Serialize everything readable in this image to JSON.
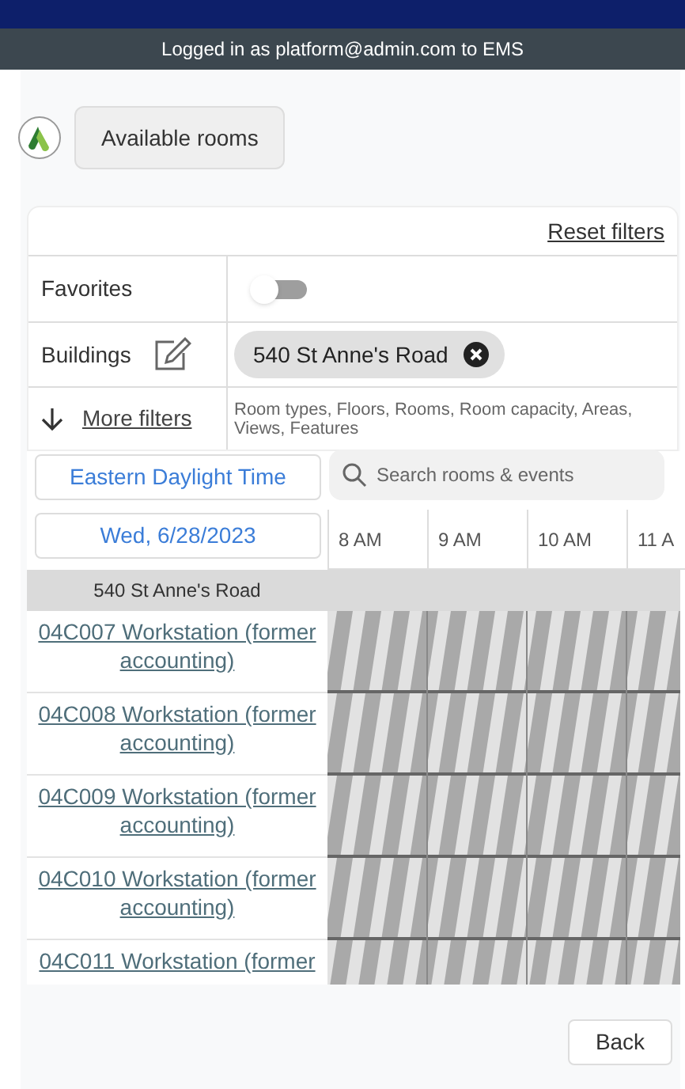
{
  "header": {
    "login_text": "Logged in as platform@admin.com to EMS"
  },
  "page_button": "Available rooms",
  "filters": {
    "reset": "Reset filters",
    "favorites": {
      "label": "Favorites",
      "on": false
    },
    "buildings": {
      "label": "Buildings",
      "chips": [
        "540 St Anne's Road"
      ]
    },
    "more": {
      "label": "More filters",
      "summary": "Room types, Floors, Rooms, Room capacity, Areas, Views, Features"
    }
  },
  "timezone": "Eastern Daylight Time",
  "search": {
    "placeholder": "Search rooms & events"
  },
  "date": "Wed, 6/28/2023",
  "hours": [
    "8 AM",
    "9 AM",
    "10 AM",
    "11 A"
  ],
  "building_group": "540 St Anne's Road",
  "rooms": [
    {
      "name": "04C007 Workstation (former accounting)"
    },
    {
      "name": "04C008 Workstation (former accounting)"
    },
    {
      "name": "04C009 Workstation (former accounting)"
    },
    {
      "name": "04C010 Workstation (former accounting)"
    },
    {
      "name": "04C011 Workstation (former"
    }
  ],
  "back": "Back"
}
